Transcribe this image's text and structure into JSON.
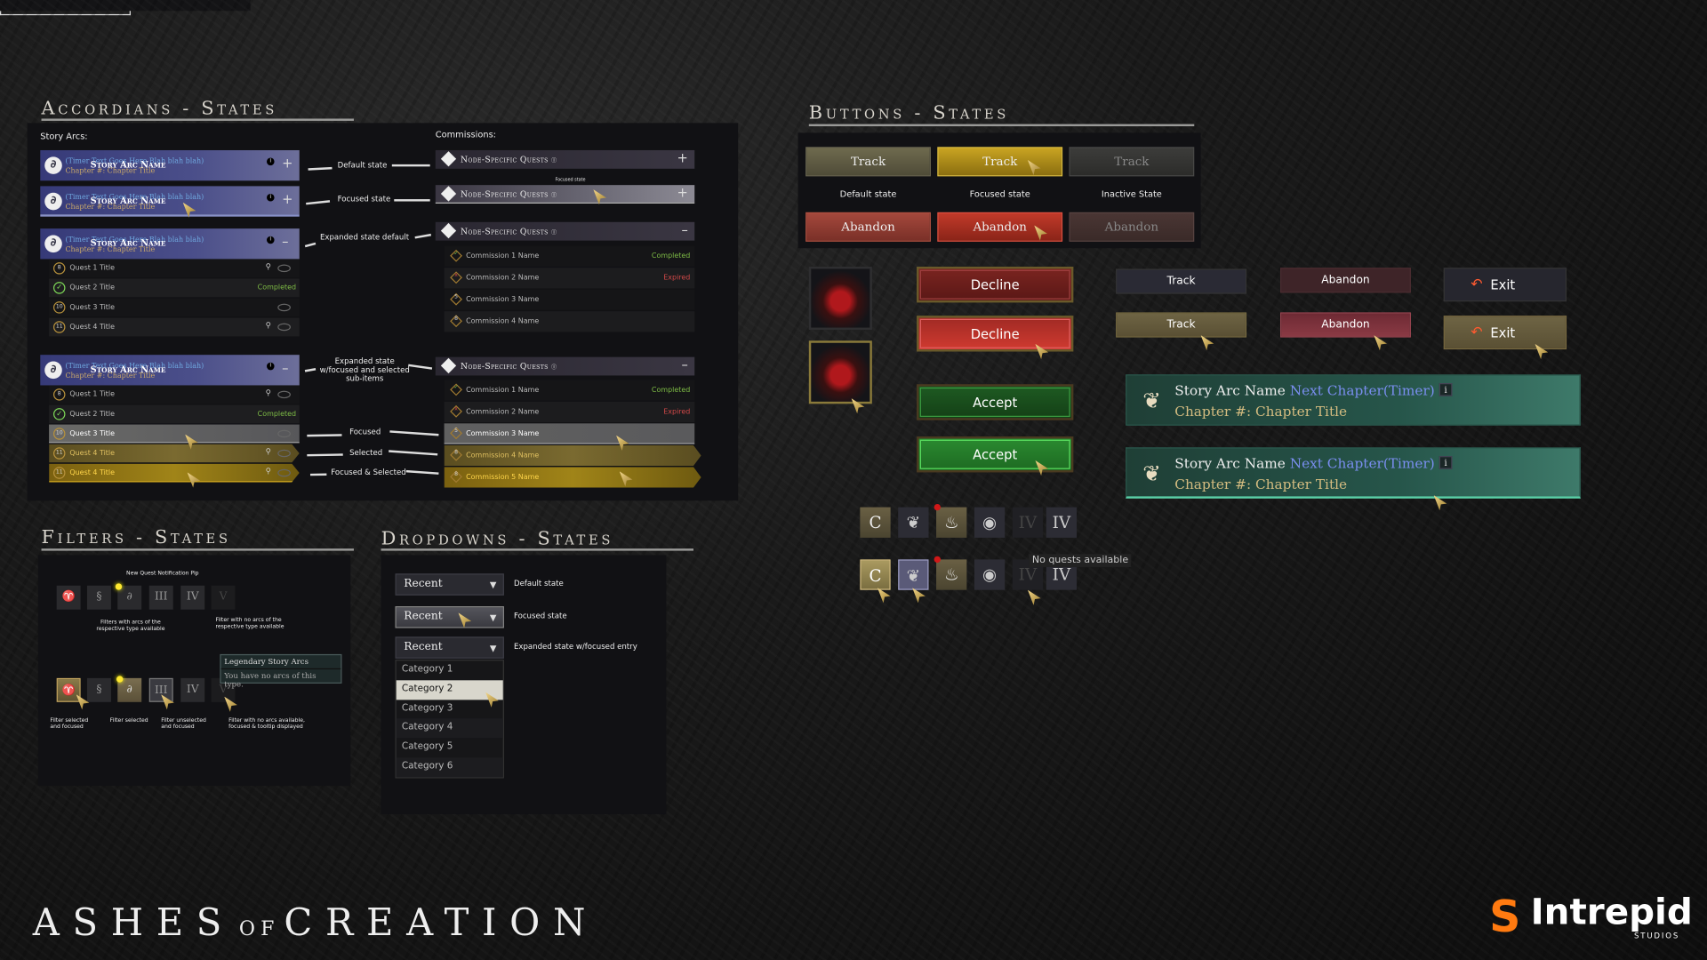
{
  "accordions": {
    "title": "Accordians - States",
    "story_arcs_label": "Story Arcs:",
    "commissions_label": "Commissions:",
    "arc": {
      "name": "Story Arc Name",
      "timer": "(Timer Text Goes Here Blah blah blah)",
      "chapter": "Chapter #: Chapter Title",
      "info": "i"
    },
    "arc_states": [
      "Default state",
      "Focused state",
      "Expanded state default",
      "Expanded state w/focused and selected sub-items"
    ],
    "quests_a": [
      {
        "num": "8",
        "title": "Quest 1 Title",
        "status": "",
        "state": "default"
      },
      {
        "num": "✓",
        "title": "Quest 2 Title",
        "status": "Completed",
        "state": "default"
      },
      {
        "num": "10",
        "title": "Quest 3 Title",
        "status": "",
        "state": "default"
      },
      {
        "num": "11",
        "title": "Quest 4 Title",
        "status": "",
        "state": "default"
      }
    ],
    "quests_b": [
      {
        "num": "8",
        "title": "Quest 1 Title",
        "status": "",
        "state": "default"
      },
      {
        "num": "✓",
        "title": "Quest 2 Title",
        "status": "Completed",
        "state": "default"
      },
      {
        "num": "10",
        "title": "Quest 3 Title",
        "status": "",
        "state": "focused"
      },
      {
        "num": "11",
        "title": "Quest 4 Title",
        "status": "",
        "state": "selected"
      },
      {
        "num": "11",
        "title": "Quest 4 Title",
        "status": "",
        "state": "focused-selected"
      }
    ],
    "sub_states": [
      "Focused",
      "Selected",
      "Focused & Selected"
    ],
    "commission_header": "Node-Specific Quests",
    "focused_state_note": "Focused state",
    "commissions_a": [
      {
        "num": "✓",
        "title": "Commission 1 Name",
        "status": "Completed",
        "state": "default"
      },
      {
        "num": "x",
        "title": "Commission 2 Name",
        "status": "Expired",
        "state": "default"
      },
      {
        "num": "5",
        "title": "Commission 3 Name",
        "status": "",
        "state": "default"
      },
      {
        "num": "8",
        "title": "Commission 4 Name",
        "status": "",
        "state": "default"
      }
    ],
    "commissions_b": [
      {
        "num": "✓",
        "title": "Commission 1 Name",
        "status": "Completed",
        "state": "default"
      },
      {
        "num": "x",
        "title": "Commission 2 Name",
        "status": "Expired",
        "state": "default"
      },
      {
        "num": "5",
        "title": "Commission 3 Name",
        "status": "",
        "state": "focused"
      },
      {
        "num": "8",
        "title": "Commission 4 Name",
        "status": "",
        "state": "selected"
      },
      {
        "num": "8",
        "title": "Commission 5 Name",
        "status": "",
        "state": "focused-selected"
      }
    ]
  },
  "filters": {
    "title": "Filters - States",
    "pip_label": "New Quest Notification Pip",
    "icons": [
      "harp-icon",
      "seahorse-icon",
      "swirl-icon",
      "III",
      "IV",
      "V"
    ],
    "note_available": "Filters with arcs of the respective type available",
    "note_none": "Filter with no arcs of the respective type available",
    "tooltip": {
      "title": "Legendary Story Arcs",
      "body": "You have no arcs of this type."
    },
    "captions": [
      "Filter selected and focused",
      "Filter selected",
      "Filter unselected and focused",
      "Filter with no arcs available, focused & tooltip displayed"
    ]
  },
  "dropdowns": {
    "title": "Dropdowns - States",
    "value": "Recent",
    "states": [
      "Default state",
      "Focused state",
      "Expanded state w/focused entry"
    ],
    "options": [
      "Category 1",
      "Category 2",
      "Category 3",
      "Category 4",
      "Category 5",
      "Category 6"
    ],
    "focused_option": "Category 2"
  },
  "buttons": {
    "title": "Buttons - States",
    "track": "Track",
    "abandon": "Abandon",
    "state_labels": [
      "Default state",
      "Focused state",
      "Inactive State"
    ],
    "decline": "Decline",
    "accept": "Accept",
    "exit": "Exit"
  },
  "story_card": {
    "name": "Story Arc Name",
    "timer": "Next Chapter(Timer)",
    "chapter": "Chapter #: Chapter Title",
    "info": "i"
  },
  "quest_icons": {
    "c": "C",
    "roman": "IV",
    "tooltip": "No quests available"
  },
  "branding": {
    "game_a": "Ashes",
    "game_of": "of",
    "game_b": "Creation",
    "studio": "Intrepid",
    "studio_sub": "Studios"
  },
  "colors": {
    "completed": "#7dbb45",
    "expired": "#d14848",
    "gold": "#c9a422",
    "arc_blue": "#363a78",
    "accept": "#2a8a30",
    "decline": "#a02a24"
  }
}
